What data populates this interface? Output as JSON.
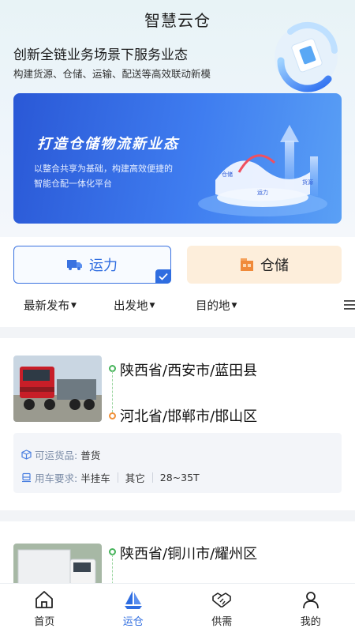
{
  "header": {
    "title": "智慧云仓",
    "slogan": "创新全链业务场景下服务业态",
    "slogan_sub": "构建货源、仓储、运输、配送等高效联动新模"
  },
  "banner": {
    "title": "打造仓储物流新业态",
    "subtitle": "以整合共享为基础，构建高效便捷的智能仓配一体化平台",
    "art_labels": [
      "仓储",
      "运力",
      "货源"
    ]
  },
  "tabs": [
    {
      "label": "运力",
      "icon": "truck-icon",
      "selected": true
    },
    {
      "label": "仓储",
      "icon": "warehouse-icon",
      "selected": false
    }
  ],
  "filters": [
    {
      "label": "最新发布"
    },
    {
      "label": "出发地"
    },
    {
      "label": "目的地"
    }
  ],
  "listings": [
    {
      "from": "陕西省/西安市/蓝田县",
      "to": "河北省/邯郸市/邯山区",
      "goods_label": "可运货品:",
      "goods_value": "普货",
      "req_label": "用车要求:",
      "req_values": [
        "半挂车",
        "其它",
        "28~35T"
      ]
    },
    {
      "from": "陕西省/铜川市/耀州区"
    }
  ],
  "nav": [
    {
      "label": "首页",
      "icon": "home-icon",
      "active": false
    },
    {
      "label": "运仓",
      "icon": "sail-icon",
      "active": true
    },
    {
      "label": "供需",
      "icon": "handshake-icon",
      "active": false
    },
    {
      "label": "我的",
      "icon": "user-icon",
      "active": false
    }
  ],
  "colors": {
    "accent": "#2f6de0",
    "start_dot": "#46b35a",
    "end_dot": "#f0913a",
    "warehouse_tab_bg": "#fdeedb"
  }
}
